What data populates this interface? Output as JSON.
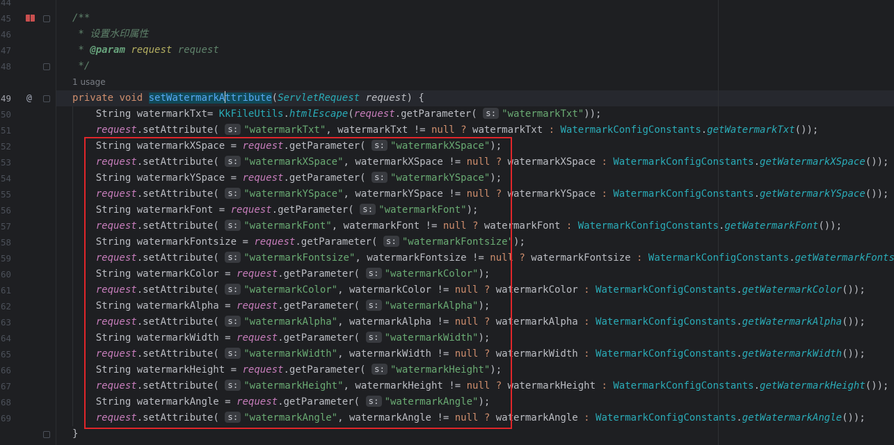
{
  "editor": {
    "lines": [
      {
        "n": "44",
        "kind": "blank"
      },
      {
        "n": "45",
        "kind": "doc",
        "text": "/**"
      },
      {
        "n": "46",
        "kind": "doc",
        "text": " * 设置水印属性"
      },
      {
        "n": "47",
        "kind": "docparam",
        "pre": " * ",
        "tag": "@param",
        "name": "request",
        "desc": "request"
      },
      {
        "n": "48",
        "kind": "doc",
        "text": " */"
      },
      {
        "n": "",
        "kind": "usage",
        "text": "1 usage"
      },
      {
        "n": "49",
        "kind": "decl",
        "kw1": "private",
        "kw2": "void",
        "fn_a": "setWatermarkA",
        "fn_b": "ttribute",
        "ptype": "ServletRequest",
        "pname": "request",
        "tail": ") {"
      },
      {
        "n": "50",
        "kind": "get",
        "type": "String",
        "var": "watermarkTxt",
        "eq": "= ",
        "cls": "KkFileUtils",
        "method": "htmlEscape",
        "inner_local": "request",
        "inner_method": "getParameter",
        "hint": "s:",
        "key": "\"watermarkTxt\"",
        "end": "));"
      },
      {
        "n": "51",
        "kind": "set",
        "local": "request",
        "method": "setAttribute",
        "hint": "s:",
        "key": "\"watermarkTxt\"",
        "var": "watermarkTxt",
        "nul": "null",
        "cls": "WatermarkConfigConstants",
        "getter": "getWatermarkTxt"
      },
      {
        "n": "52",
        "kind": "param",
        "type": "String",
        "var": "watermarkXSpace",
        "local": "request",
        "method": "getParameter",
        "hint": "s:",
        "key": "\"watermarkXSpace\""
      },
      {
        "n": "53",
        "kind": "set",
        "local": "request",
        "method": "setAttribute",
        "hint": "s:",
        "key": "\"watermarkXSpace\"",
        "var": "watermarkXSpace",
        "nul": "null",
        "cls": "WatermarkConfigConstants",
        "getter": "getWatermarkXSpace"
      },
      {
        "n": "54",
        "kind": "param",
        "type": "String",
        "var": "watermarkYSpace",
        "local": "request",
        "method": "getParameter",
        "hint": "s:",
        "key": "\"watermarkYSpace\""
      },
      {
        "n": "55",
        "kind": "set",
        "local": "request",
        "method": "setAttribute",
        "hint": "s:",
        "key": "\"watermarkYSpace\"",
        "var": "watermarkYSpace",
        "nul": "null",
        "cls": "WatermarkConfigConstants",
        "getter": "getWatermarkYSpace"
      },
      {
        "n": "56",
        "kind": "param",
        "type": "String",
        "var": "watermarkFont",
        "local": "request",
        "method": "getParameter",
        "hint": "s:",
        "key": "\"watermarkFont\""
      },
      {
        "n": "57",
        "kind": "set",
        "local": "request",
        "method": "setAttribute",
        "hint": "s:",
        "key": "\"watermarkFont\"",
        "var": "watermarkFont",
        "nul": "null",
        "cls": "WatermarkConfigConstants",
        "getter": "getWatermarkFont"
      },
      {
        "n": "58",
        "kind": "param",
        "type": "String",
        "var": "watermarkFontsize",
        "local": "request",
        "method": "getParameter",
        "hint": "s:",
        "key": "\"watermarkFontsize\""
      },
      {
        "n": "59",
        "kind": "set",
        "local": "request",
        "method": "setAttribute",
        "hint": "s:",
        "key": "\"watermarkFontsize\"",
        "var": "watermarkFontsize",
        "nul": "null",
        "cls": "WatermarkConfigConstants",
        "getter": "getWatermarkFontsize"
      },
      {
        "n": "60",
        "kind": "param",
        "type": "String",
        "var": "watermarkColor",
        "local": "request",
        "method": "getParameter",
        "hint": "s:",
        "key": "\"watermarkColor\""
      },
      {
        "n": "61",
        "kind": "set",
        "local": "request",
        "method": "setAttribute",
        "hint": "s:",
        "key": "\"watermarkColor\"",
        "var": "watermarkColor",
        "nul": "null",
        "cls": "WatermarkConfigConstants",
        "getter": "getWatermarkColor"
      },
      {
        "n": "62",
        "kind": "param",
        "type": "String",
        "var": "watermarkAlpha",
        "local": "request",
        "method": "getParameter",
        "hint": "s:",
        "key": "\"watermarkAlpha\""
      },
      {
        "n": "63",
        "kind": "set",
        "local": "request",
        "method": "setAttribute",
        "hint": "s:",
        "key": "\"watermarkAlpha\"",
        "var": "watermarkAlpha",
        "nul": "null",
        "cls": "WatermarkConfigConstants",
        "getter": "getWatermarkAlpha"
      },
      {
        "n": "64",
        "kind": "param",
        "type": "String",
        "var": "watermarkWidth",
        "local": "request",
        "method": "getParameter",
        "hint": "s:",
        "key": "\"watermarkWidth\""
      },
      {
        "n": "65",
        "kind": "set",
        "local": "request",
        "method": "setAttribute",
        "hint": "s:",
        "key": "\"watermarkWidth\"",
        "var": "watermarkWidth",
        "nul": "null",
        "cls": "WatermarkConfigConstants",
        "getter": "getWatermarkWidth"
      },
      {
        "n": "66",
        "kind": "param",
        "type": "String",
        "var": "watermarkHeight",
        "local": "request",
        "method": "getParameter",
        "hint": "s:",
        "key": "\"watermarkHeight\""
      },
      {
        "n": "67",
        "kind": "set",
        "local": "request",
        "method": "setAttribute",
        "hint": "s:",
        "key": "\"watermarkHeight\"",
        "var": "watermarkHeight",
        "nul": "null",
        "cls": "WatermarkConfigConstants",
        "getter": "getWatermarkHeight"
      },
      {
        "n": "68",
        "kind": "param",
        "type": "String",
        "var": "watermarkAngle",
        "local": "request",
        "method": "getParameter",
        "hint": "s:",
        "key": "\"watermarkAngle\""
      },
      {
        "n": "69",
        "kind": "set",
        "local": "request",
        "method": "setAttribute",
        "hint": "s:",
        "key": "\"watermarkAngle\"",
        "var": "watermarkAngle",
        "nul": "null",
        "cls": "WatermarkConfigConstants",
        "getter": "getWatermarkAngle"
      },
      {
        "n": "",
        "kind": "close",
        "text": "}"
      }
    ]
  },
  "colors": {
    "background": "#1e1f22",
    "keyword": "#cf8e6d",
    "string": "#6aab73",
    "method_decl": "#56a8f5",
    "local_var": "#c77dbb",
    "static_call": "#2aacb8",
    "doc_comment": "#5f826b",
    "highlight_box": "#e0262a"
  },
  "icons": {
    "bookmark": "bookmark-icon",
    "override": "implements-icon"
  }
}
